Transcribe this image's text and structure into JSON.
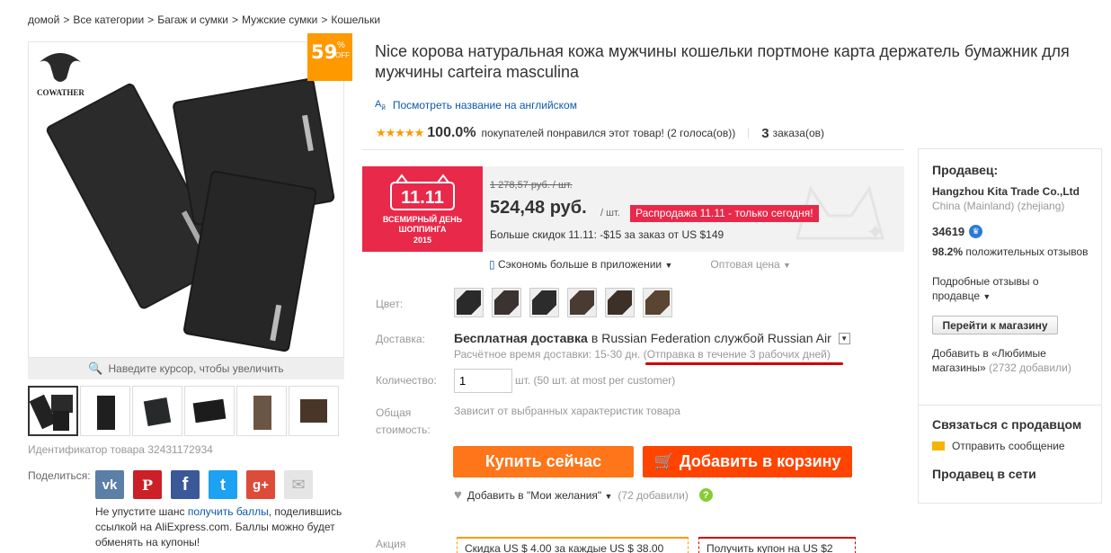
{
  "breadcrumb": [
    "домой",
    "Все категории",
    "Багаж и сумки",
    "Мужские сумки",
    "Кошельки"
  ],
  "image": {
    "brand": "COWATHER",
    "zoom_hint": "Наведите курсор, чтобы увеличить",
    "discount": {
      "value": "59",
      "pct": "%",
      "off": "OFF"
    }
  },
  "product_id": "Идентификатор товара 32431172934",
  "share": {
    "label": "Поделиться:",
    "note_before": "Не упустите шанс ",
    "note_link": "получить баллы",
    "note_after": ", поделившись ссылкой на AliExpress.com. Баллы можно будет обменять на купоны!",
    "networks": [
      {
        "name": "vk",
        "glyph": "vk",
        "color": "#5b7fa6"
      },
      {
        "name": "pinterest",
        "glyph": "P",
        "color": "#cb2027"
      },
      {
        "name": "facebook",
        "glyph": "f",
        "color": "#3b5998"
      },
      {
        "name": "twitter",
        "glyph": "t",
        "color": "#1da1f2"
      },
      {
        "name": "google-plus",
        "glyph": "g+",
        "color": "#dd4b39"
      },
      {
        "name": "email",
        "glyph": "✉",
        "color": "#ddd"
      }
    ]
  },
  "title": "Nice корова натуральная кожа мужчины кошельки портмоне карта держатель бумажник для мужчины carteira masculina",
  "translate_link": "Посмотреть название на английском",
  "rating": {
    "stars": "★★★★★",
    "percent": "100.0%",
    "text": "покупателей понравился этот товар! (2 голоса(ов))",
    "orders_count": "3",
    "orders_label": "заказа(ов)"
  },
  "promo": {
    "line1": "11.11",
    "line2": "ВСЕМИРНЫЙ ДЕНЬ",
    "line3": "ШОППИНГА",
    "year": "2015"
  },
  "price": {
    "old": "1 278,57 руб. / шт.",
    "new": "524,48 руб.",
    "unit": "/ шт.",
    "sale_badge": "Распродажа 11.11 - только сегодня!",
    "more_discounts": "Больше скидок 11.11: -$15 за заказ от US $149"
  },
  "app_row": {
    "save_app": "Сэкономь больше в приложении",
    "wholesale": "Оптовая цена"
  },
  "props": {
    "color_label": "Цвет:",
    "swatch_colors": [
      "#2a2a2a",
      "#3a3330",
      "#2c2c2c",
      "#4a3b32",
      "#3d3026",
      "#5a4432"
    ],
    "shipping_label": "Доставка:",
    "shipping_free": "Бесплатная доставка",
    "shipping_in": "в",
    "shipping_dest": "Russian Federation службой Russian Air",
    "shipping_time": "Расчётное время доставки: 15-30 дн.",
    "shipping_dispatch": "(Отправка в течение 3 рабочих дней)",
    "qty_label": "Количество:",
    "qty_value": "1",
    "qty_note": "шт. (50 шт. at most per customer)",
    "total_label": "Общая стоимость:",
    "total_value": "Зависит от выбранных характеристик товара"
  },
  "buttons": {
    "buy_now": "Купить сейчас",
    "add_cart": "Добавить в корзину"
  },
  "wishlist": {
    "label": "Добавить в \"Мои желания\"",
    "count": "(72 добавили)"
  },
  "promotion": {
    "label": "Акция",
    "coupon1": "Скидка US $ 4.00 за каждые US $ 38.00",
    "coupon2": "Получить купон на US $2"
  },
  "seller": {
    "title": "Продавец:",
    "name": "Hangzhou Kita Trade Co.,Ltd",
    "location": "China (Mainland) (zhejiang)",
    "score": "34619",
    "positive_pct": "98.2%",
    "positive_text": "положительных отзывов",
    "details": "Подробные отзывы о продавце",
    "store_button": "Перейти к магазину",
    "fav_link": "Добавить в «Любимые магазины»",
    "fav_count": "(2732 добавили)",
    "contact_title": "Связаться с продавцом",
    "send_message": "Отправить сообщение",
    "online_title": "Продавец в сети"
  }
}
